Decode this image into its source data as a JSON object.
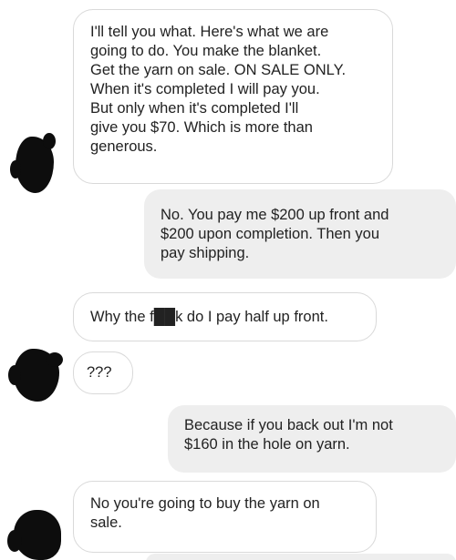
{
  "messages": [
    {
      "sender": "them",
      "text": "I'll tell you what. Here's what we are\ngoing to do.  You make the blanket.\nGet the yarn on sale. ON SALE ONLY.\nWhen it's completed I will pay you.\nBut only when it's completed I'll\ngive you $70. Which is more than\ngenerous."
    },
    {
      "sender": "me",
      "text": "No. You pay me $200 up front and\n$200 upon completion. Then you\npay shipping."
    },
    {
      "sender": "them",
      "text": "Why the f██k do I pay half up front."
    },
    {
      "sender": "them",
      "text": "???"
    },
    {
      "sender": "me",
      "text": "Because if you back out I'm not\n$160 in the hole on yarn."
    },
    {
      "sender": "them",
      "text": "No you're going to buy the yarn on\nsale."
    }
  ],
  "colors": {
    "incoming_bubble": "#ffffff",
    "incoming_border": "#d9d9d9",
    "outgoing_bubble": "#eeeeee",
    "avatar_redaction": "#0d0d0d",
    "text": "#222222"
  }
}
